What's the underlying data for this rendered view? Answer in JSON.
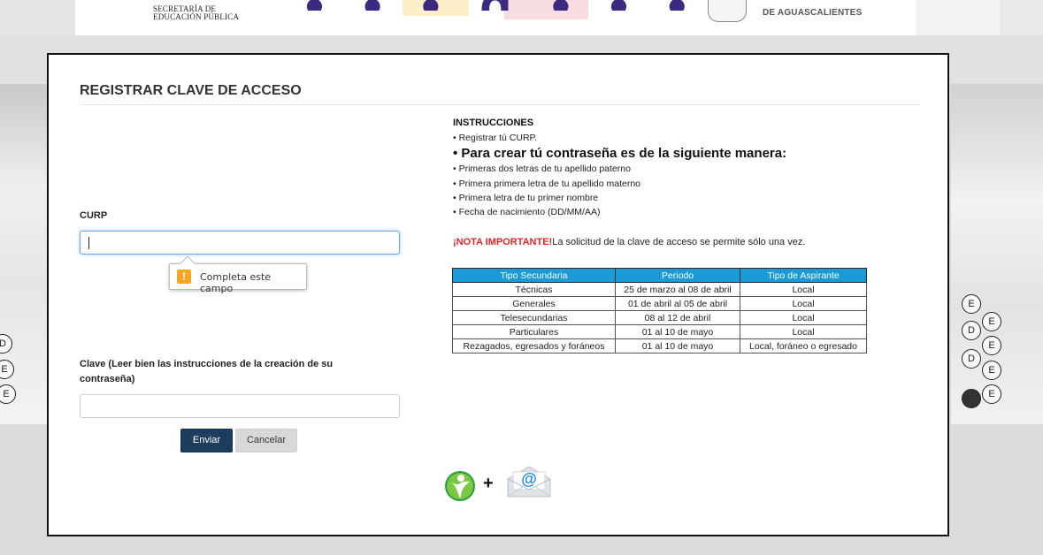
{
  "banner": {
    "sep_line1": "SECRETARÍA DE",
    "sep_line2": "EDUCACIÓN PÚBLICA",
    "state_text": "DE AGUASCALIENTES"
  },
  "form": {
    "title": "REGISTRAR CLAVE DE ACCESO",
    "curp_label": "CURP",
    "curp_value": "",
    "tooltip_text": "Completa este campo",
    "clave_label": "Clave (Leer bien las instrucciones de la creación de su contraseña)",
    "clave_value": "",
    "submit_label": "Enviar",
    "cancel_label": "Cancelar"
  },
  "instructions": {
    "heading": "INSTRUCCIONES",
    "step1": "• Registrar tú CURP.",
    "password_heading": "• Para crear tú contraseña es de la siguiente manera:",
    "rules": [
      "• Primeras dos letras de tu apellido paterno",
      "• Primera primera letra de tu apellido materno",
      "• Primera letra de tu primer nombre",
      "• Fecha de nacimiento (DD/MM/AA)"
    ],
    "note_label": "¡NOTA IMPORTANTE!",
    "note_text": "La solicitud de la clave de acceso se permite sólo una vez."
  },
  "schedule": {
    "headers": [
      "Tipo Secundaria",
      "Periodo",
      "Tipo de Aspirante"
    ],
    "rows": [
      [
        "Técnicas",
        "25 de marzo al 08 de abril",
        "Local"
      ],
      [
        "Generales",
        "01 de abril al 05 de abril",
        "Local"
      ],
      [
        "Telesecundarias",
        "08 al 12 de abril",
        "Local"
      ],
      [
        "Particulares",
        "01 al 10 de mayo",
        "Local"
      ],
      [
        "Rezagados, egresados y foráneos",
        "01 al 10 de mayo",
        "Local, foráneo o egresado"
      ]
    ]
  },
  "footer": {
    "plus_sign": "+",
    "email_symbol": "@"
  },
  "colors": {
    "primary_button": "#1c3d5e",
    "table_header": "#1a9ad6",
    "note_red": "#e8232a",
    "warning": "#f5a623"
  }
}
